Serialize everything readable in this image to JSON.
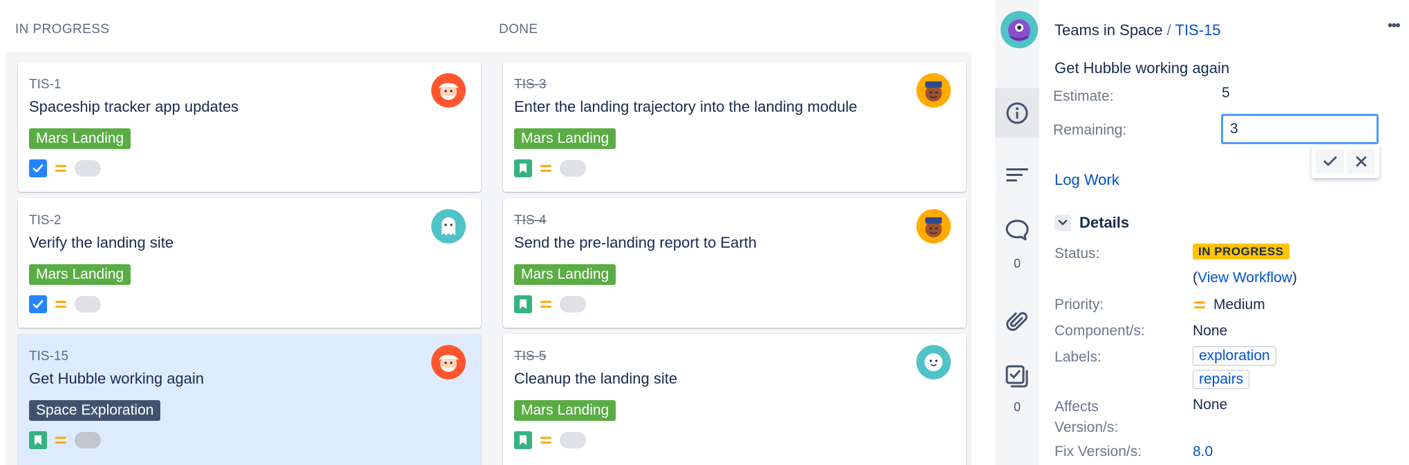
{
  "board": {
    "columns": [
      {
        "title": "IN PROGRESS",
        "cards": [
          {
            "key": "TIS-1",
            "summary": "Spaceship tracker app updates",
            "epic": "Mars Landing",
            "type": "task-icon"
          },
          {
            "key": "TIS-2",
            "summary": "Verify the landing site",
            "epic": "Mars Landing",
            "type": "task-icon"
          },
          {
            "key": "TIS-15",
            "summary": "Get Hubble working again",
            "epic": "Space Exploration",
            "type": "story-icon"
          }
        ]
      },
      {
        "title": "DONE",
        "cards": [
          {
            "key": "TIS-3",
            "summary": "Enter the landing trajectory into the landing module",
            "epic": "Mars Landing",
            "type": "story-icon"
          },
          {
            "key": "TIS-4",
            "summary": "Send the pre-landing report to Earth",
            "epic": "Mars Landing",
            "type": "story-icon"
          },
          {
            "key": "TIS-5",
            "summary": "Cleanup the landing site",
            "epic": "Mars Landing",
            "type": "story-icon"
          }
        ]
      }
    ]
  },
  "colors": {
    "epic_green": "#5aac44",
    "epic_dark": "#42526e",
    "task_blue": "#2684ff",
    "story_green": "#36b37e",
    "priority_medium": "#ffab00",
    "link": "#0052cc",
    "status_yellow": "#ffc400",
    "selected_card": "#deebff"
  },
  "detail": {
    "project": "Teams in Space",
    "separator": "/",
    "issue_key": "TIS-15",
    "summary": "Get Hubble working again",
    "estimate_label": "Estimate:",
    "estimate_value": "5",
    "remaining_label": "Remaining:",
    "remaining_value": "3",
    "log_work": "Log Work",
    "details_title": "Details",
    "status_label": "Status:",
    "status_value": "IN PROGRESS",
    "view_workflow_open": "(",
    "view_workflow": "View Workflow",
    "view_workflow_close": ")",
    "priority_label": "Priority:",
    "priority_value": "Medium",
    "component_label": "Component/s:",
    "component_value": "None",
    "labels_label": "Labels:",
    "labels": [
      "exploration",
      "repairs"
    ],
    "affects_label_1": "Affects",
    "affects_label_2": "Version/s:",
    "affects_value": "None",
    "fix_label": "Fix Version/s:",
    "fix_value": "8.0",
    "more": "•••"
  },
  "rail": {
    "comments_count": "0",
    "subtasks_count": "0"
  }
}
